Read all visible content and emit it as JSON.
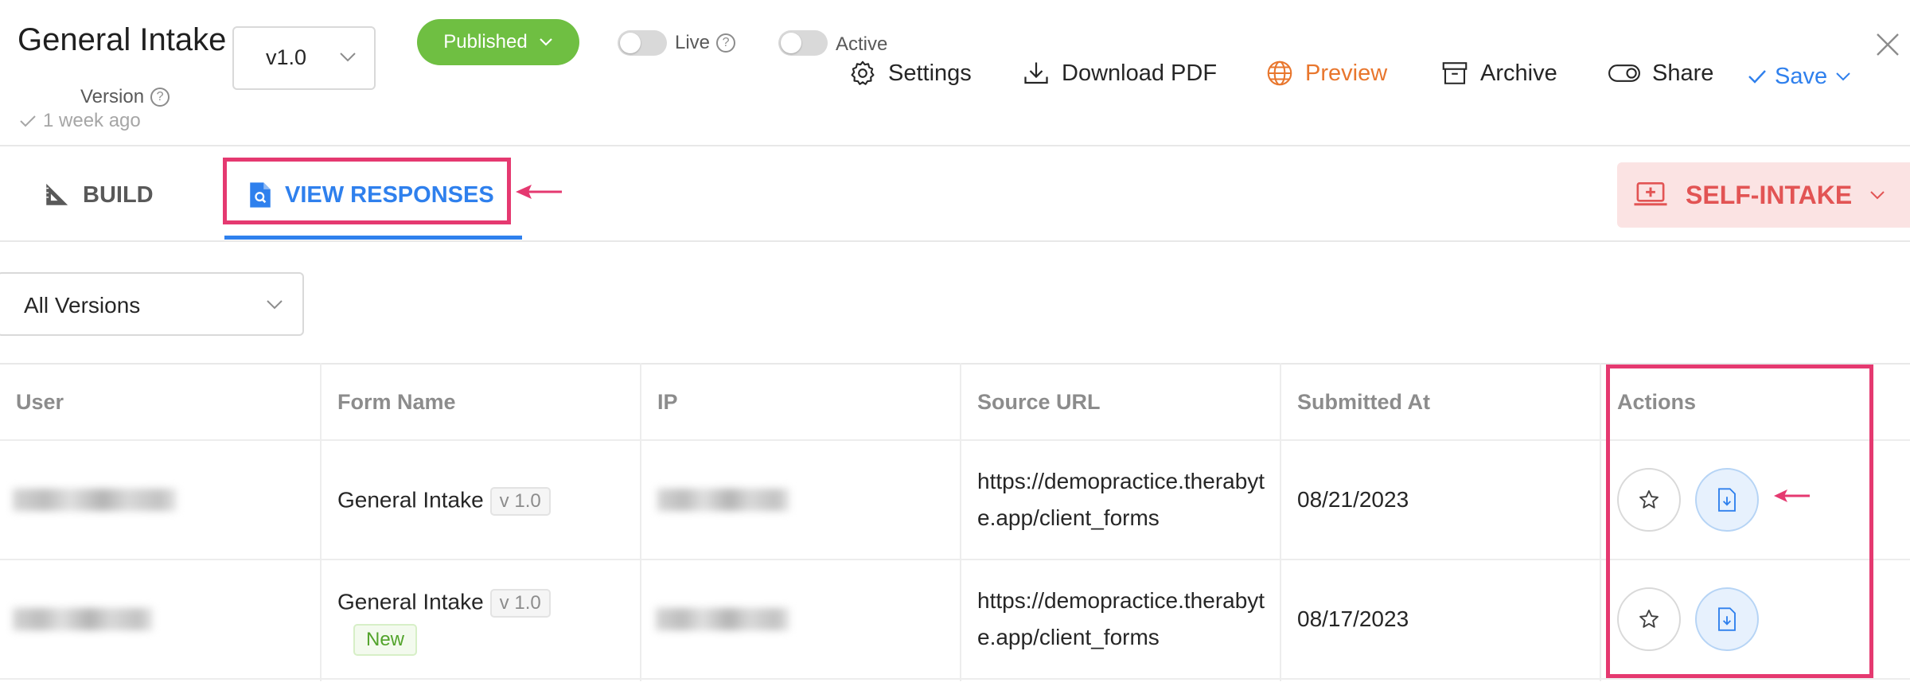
{
  "header": {
    "form_title": "General Intake",
    "version_value": "v1.0",
    "version_label": "Version",
    "updated_ago": "1 week ago",
    "status_button": "Published",
    "live_label": "Live",
    "active_label": "Active",
    "toolbar": {
      "settings": "Settings",
      "download_pdf": "Download PDF",
      "preview": "Preview",
      "archive": "Archive",
      "share": "Share",
      "save": "Save"
    }
  },
  "tabs": {
    "build": "BUILD",
    "view_responses": "VIEW RESPONSES",
    "active_tab": "VIEW RESPONSES"
  },
  "self_intake": "SELF-INTAKE",
  "filter": {
    "selected": "All Versions"
  },
  "table": {
    "columns": [
      "User",
      "Form Name",
      "IP",
      "Source URL",
      "Submitted At",
      "Actions"
    ],
    "rows": [
      {
        "user": "",
        "form_name": "General Intake",
        "version_tag": "v 1.0",
        "badge": "",
        "ip": "",
        "source_url": "https://demopractice.therabyte.app/client_forms",
        "submitted_at": "08/21/2023"
      },
      {
        "user": "",
        "form_name": "General Intake",
        "version_tag": "v 1.0",
        "badge": "New",
        "ip": "",
        "source_url": "https://demopractice.therabyte.app/client_forms",
        "submitted_at": "08/17/2023"
      }
    ]
  },
  "colors": {
    "accent_blue": "#2f80ed",
    "published_green": "#6fbf42",
    "preview_orange": "#e8762d",
    "self_intake_red": "#e25454",
    "annotation_pink": "#e53970"
  }
}
